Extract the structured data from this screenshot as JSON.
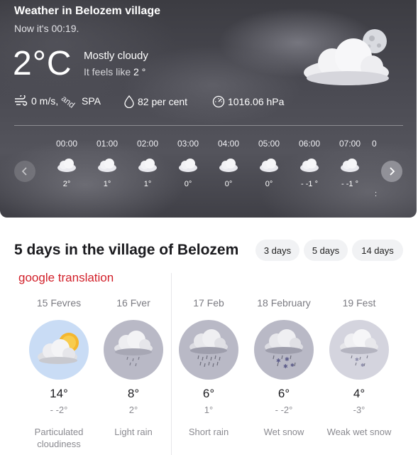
{
  "current": {
    "title": "Weather in Belozem village",
    "now_text": "Now it's 00:19.",
    "temp": "2°C",
    "condition": "Mostly cloudy",
    "feels_like_prefix": "It feels like ",
    "feels_like_value": "2 °",
    "wind_value": "0 m/s,",
    "wind_joiner": "and",
    "wind_dir": "SPA",
    "humidity": "82 per cent",
    "pressure": "1016.06 hPa",
    "icon": "cloud-moon-icon"
  },
  "hourly": [
    {
      "time": "00:00",
      "temp": "2°"
    },
    {
      "time": "01:00",
      "temp": "1°"
    },
    {
      "time": "02:00",
      "temp": "1°"
    },
    {
      "time": "03:00",
      "temp": "0°"
    },
    {
      "time": "04:00",
      "temp": "0°"
    },
    {
      "time": "05:00",
      "temp": "0°"
    },
    {
      "time": "06:00",
      "temp": "- -1 °"
    },
    {
      "time": "07:00",
      "temp": "- -1 °"
    }
  ],
  "hourly_partial": {
    "time": "0",
    "temp": ":"
  },
  "forecast": {
    "title": "5 days in the village of Belozem",
    "tabs": [
      "3 days",
      "5 days",
      "14 days"
    ],
    "translation_label": "google translation",
    "days": [
      {
        "date": "15 Fevres",
        "high": "14°",
        "low": "- -2°",
        "desc": "Particulated cloudiness",
        "icon": "partly-cloudy-icon"
      },
      {
        "date": "16 Fver",
        "high": "8°",
        "low": "2°",
        "desc": "Light rain",
        "icon": "light-rain-icon"
      },
      {
        "date": "17 Feb",
        "high": "6°",
        "low": "1°",
        "desc": "Short rain",
        "icon": "rain-icon"
      },
      {
        "date": "18 February",
        "high": "6°",
        "low": "- -2°",
        "desc": "Wet snow",
        "icon": "wet-snow-icon"
      },
      {
        "date": "19 Fest",
        "high": "4°",
        "low": "-3°",
        "desc": "Weak wet snow",
        "icon": "weak-wet-snow-icon"
      }
    ]
  },
  "colors": {
    "hero_bg": "#4a4a52",
    "day_circle_1": "#c9dcf5",
    "day_circle_other": "#b9b9c6",
    "translation_red": "#d2202a",
    "sun": "#f5b72e"
  }
}
